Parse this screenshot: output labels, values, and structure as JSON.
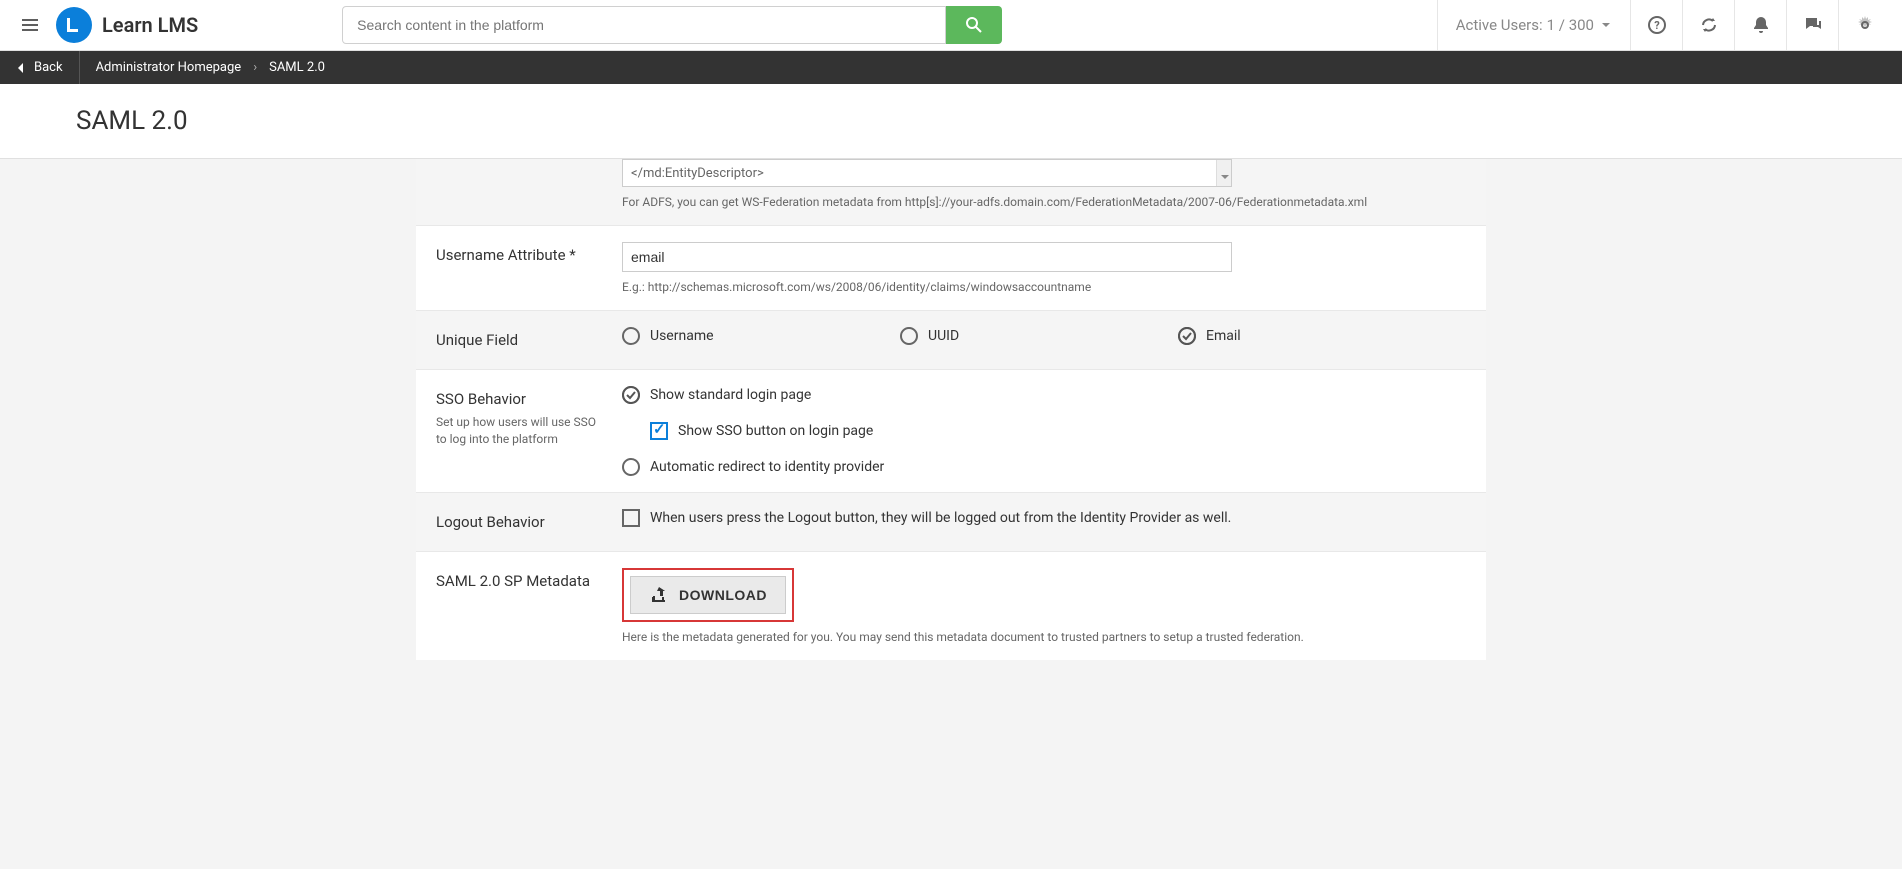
{
  "header": {
    "logo_text": "Learn LMS",
    "search_placeholder": "Search content in the platform",
    "active_users_label": "Active Users:",
    "active_users_count": "1 / 300"
  },
  "subheader": {
    "back_label": "Back",
    "breadcrumb1": "Administrator Homepage",
    "breadcrumb2": "SAML 2.0"
  },
  "page_title": "SAML 2.0",
  "metadata_box": {
    "value": "</md:EntityDescriptor>",
    "help": "For ADFS, you can get WS-Federation metadata from http[s]://your-adfs.domain.com/FederationMetadata/2007-06/Federationmetadata.xml"
  },
  "username_attr": {
    "label": "Username Attribute *",
    "value": "email",
    "help": "E.g.: http://schemas.microsoft.com/ws/2008/06/identity/claims/windowsaccountname"
  },
  "unique_field": {
    "label": "Unique Field",
    "opt1": "Username",
    "opt2": "UUID",
    "opt3": "Email"
  },
  "sso_behavior": {
    "label": "SSO Behavior",
    "sublabel": "Set up how users will use SSO to log into the platform",
    "opt1": "Show standard login page",
    "opt1a": "Show SSO button on login page",
    "opt2": "Automatic redirect to identity provider"
  },
  "logout_behavior": {
    "label": "Logout Behavior",
    "opt1": "When users press the Logout button, they will be logged out from the Identity Provider as well."
  },
  "sp_metadata": {
    "label": "SAML 2.0 SP Metadata",
    "button": "DOWNLOAD",
    "help": "Here is the metadata generated for you. You may send this metadata document to trusted partners to setup a trusted federation."
  }
}
